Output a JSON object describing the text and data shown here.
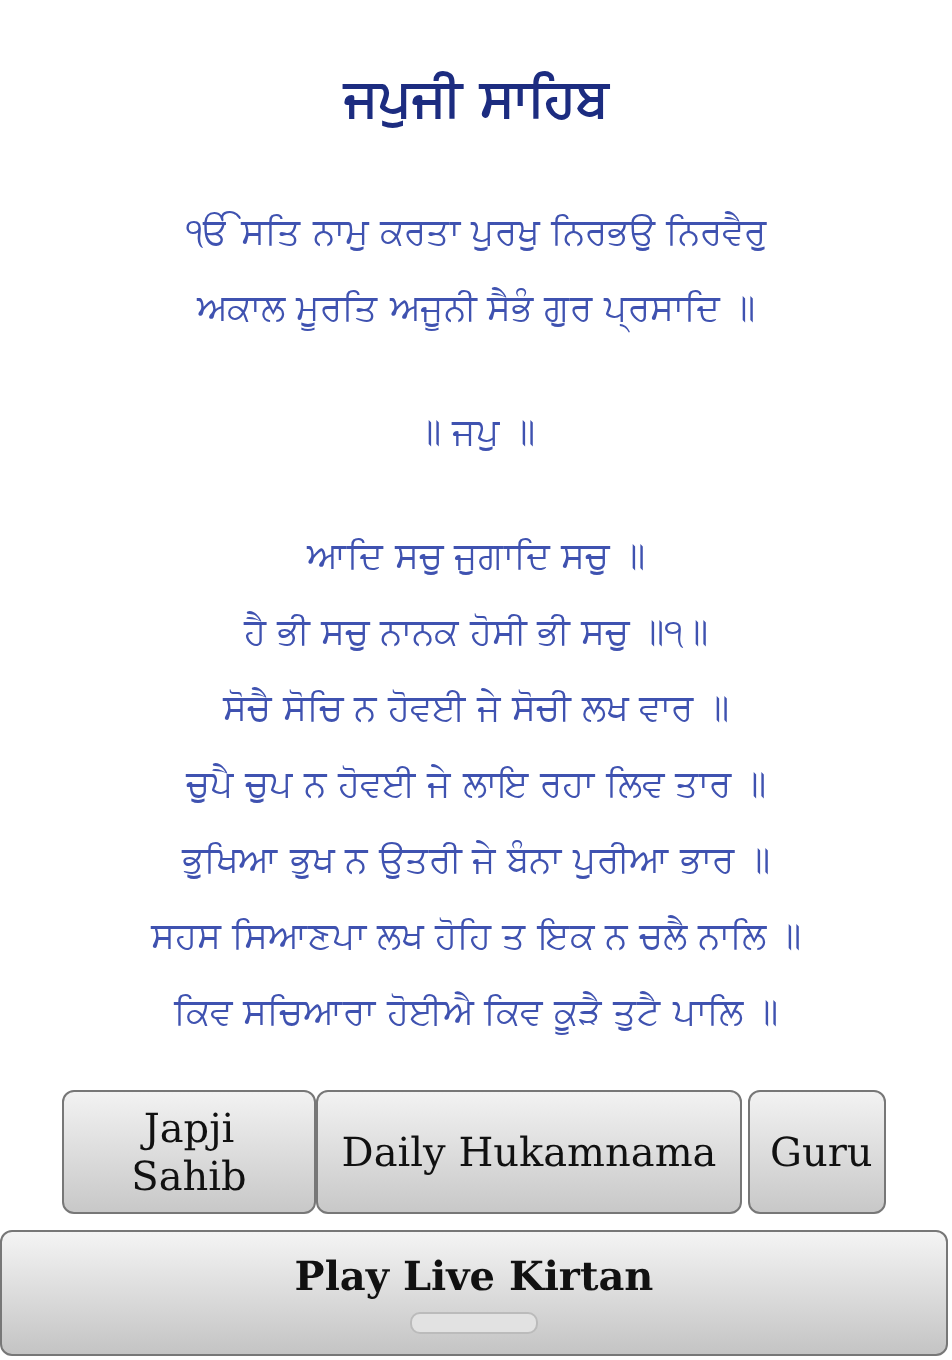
{
  "title": "ਜਪੁਜੀ ਸਾਹਿਬ",
  "stanzas": [
    {
      "lines": [
        "ੴ ਸਤਿ ਨਾਮੁ ਕਰਤਾ ਪੁਰਖੁ ਨਿਰਭਉ ਨਿਰਵੈਰੁ",
        "ਅਕਾਲ ਮੂਰਤਿ ਅਜੂਨੀ ਸੈਭੰ ਗੁਰ ਪ੍ਰਸਾਦਿ ॥"
      ]
    },
    {
      "lines": [
        "॥ ਜਪੁ ॥"
      ]
    },
    {
      "lines": [
        "ਆਦਿ ਸਚੁ ਜੁਗਾਦਿ ਸਚੁ ॥",
        "ਹੈ ਭੀ ਸਚੁ ਨਾਨਕ ਹੋਸੀ ਭੀ ਸਚੁ ॥੧॥",
        "ਸੋਚੈ ਸੋਚਿ ਨ ਹੋਵਈ ਜੇ ਸੋਚੀ ਲਖ ਵਾਰ ॥",
        "ਚੁਪੈ ਚੁਪ ਨ ਹੋਵਈ ਜੇ ਲਾਇ ਰਹਾ ਲਿਵ ਤਾਰ ॥",
        "ਭੁਖਿਆ ਭੁਖ ਨ ਉਤਰੀ ਜੇ ਬੰਨਾ ਪੁਰੀਆ ਭਾਰ ॥",
        "ਸਹਸ ਸਿਆਣਪਾ ਲਖ ਹੋਹਿ ਤ ਇਕ ਨ ਚਲੈ ਨਾਲਿ ॥",
        "ਕਿਵ ਸਚਿਆਰਾ ਹੋਈਐ ਕਿਵ ਕੂੜੈ ਤੁਟੈ ਪਾਲਿ ॥"
      ]
    }
  ],
  "nav_buttons": [
    "Japji Sahib",
    "Daily Hukamnama",
    "Guru"
  ],
  "kirtan_toggle": {
    "label": "Play Live Kirtan",
    "on": false
  }
}
